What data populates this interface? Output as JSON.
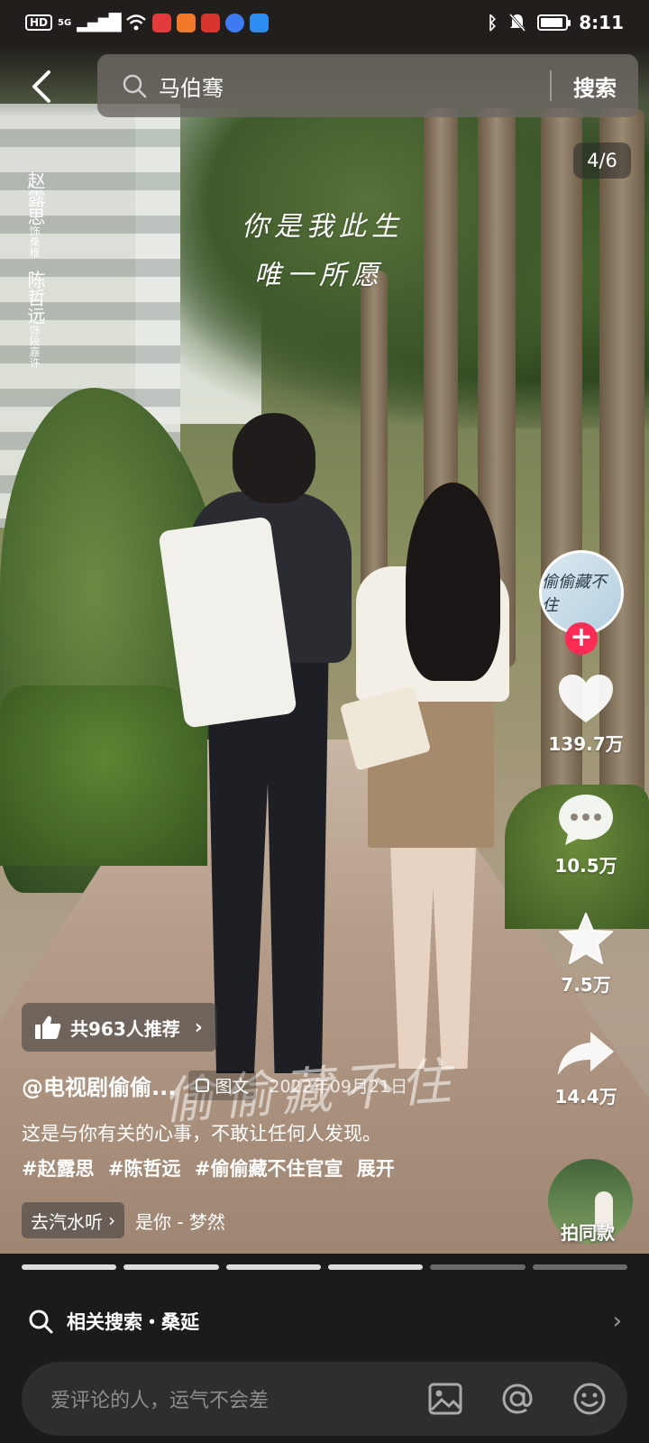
{
  "status_bar": {
    "network": "HD",
    "signal": "5G",
    "time": "8:11",
    "battery_level": 0.9
  },
  "search": {
    "query": "马伯骞",
    "button_label": "搜索"
  },
  "poster": {
    "page_counter": "4/6",
    "quote_line1": "你是我此生",
    "quote_line2": "唯一所愿",
    "title_watermark": "偷偷藏不住",
    "cast": [
      {
        "name": "赵露思",
        "role": "饰桑稚"
      },
      {
        "name": "陈哲远",
        "role": "饰段嘉许"
      }
    ]
  },
  "actions": {
    "avatar_text": "偷偷藏不住",
    "follow_symbol": "+",
    "likes": "139.7万",
    "comments": "10.5万",
    "favorites": "7.5万",
    "shares": "14.4万",
    "same_style": "拍同款"
  },
  "post": {
    "recommend": "共963人推荐",
    "author": "@电视剧偷偷...",
    "type": "图文",
    "date": "2022年09月21日",
    "description": "这是与你有关的心事，不敢让任何人发现。",
    "hashtags": [
      "#赵露思",
      "#陈哲远",
      "#偷偷藏不住官宣"
    ],
    "expand": "展开",
    "music_button": "去汽水听",
    "song": "是你 - 梦然"
  },
  "progress": {
    "total": 6,
    "current": 4
  },
  "related": {
    "label": "相关搜索・桑延"
  },
  "comment": {
    "placeholder": "爱评论的人，运气不会差"
  },
  "colors": {
    "accent": "#fe2c55",
    "background": "#1b1b1b"
  },
  "icons": [
    "back-icon",
    "search-icon",
    "heart-icon",
    "comment-icon",
    "star-icon",
    "share-icon",
    "thumbs-up-icon",
    "image-icon",
    "at-icon",
    "emoji-icon"
  ]
}
